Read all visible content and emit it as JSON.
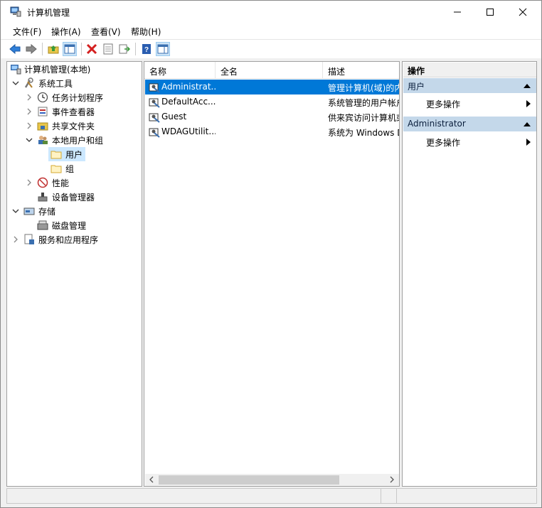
{
  "window": {
    "title": "计算机管理"
  },
  "menu": {
    "items": [
      "文件(F)",
      "操作(A)",
      "查看(V)",
      "帮助(H)"
    ]
  },
  "tree": {
    "items": [
      {
        "label": "计算机管理(本地)",
        "icon": "computer-management-icon"
      },
      {
        "label": "系统工具",
        "icon": "system-tools-icon"
      },
      {
        "label": "任务计划程序",
        "icon": "task-scheduler-icon"
      },
      {
        "label": "事件查看器",
        "icon": "event-viewer-icon"
      },
      {
        "label": "共享文件夹",
        "icon": "shared-folders-icon"
      },
      {
        "label": "本地用户和组",
        "icon": "local-users-groups-icon"
      },
      {
        "label": "用户",
        "icon": "folder-icon"
      },
      {
        "label": "组",
        "icon": "folder-icon"
      },
      {
        "label": "性能",
        "icon": "performance-icon"
      },
      {
        "label": "设备管理器",
        "icon": "device-manager-icon"
      },
      {
        "label": "存储",
        "icon": "storage-icon"
      },
      {
        "label": "磁盘管理",
        "icon": "disk-management-icon"
      },
      {
        "label": "服务和应用程序",
        "icon": "services-apps-icon"
      }
    ]
  },
  "list": {
    "columns": [
      "名称",
      "全名",
      "描述"
    ],
    "rows": [
      {
        "name": "Administrat...",
        "fullname": "",
        "desc": "管理计算机(域)的内置帐户"
      },
      {
        "name": "DefaultAcc...",
        "fullname": "",
        "desc": "系统管理的用户帐户。"
      },
      {
        "name": "Guest",
        "fullname": "",
        "desc": "供来宾访问计算机或访问域的内置帐户"
      },
      {
        "name": "WDAGUtilit...",
        "fullname": "",
        "desc": "系统为 Windows Defender 应用程序防护方案管理和使用的用户帐户。"
      }
    ]
  },
  "actions": {
    "title": "操作",
    "sections": [
      {
        "header": "用户",
        "item": "更多操作"
      },
      {
        "header": "Administrator",
        "item": "更多操作"
      }
    ]
  },
  "colors": {
    "selection": "#0078d7",
    "section_header": "#c4d8ea",
    "tree_selection": "#cce8ff"
  }
}
